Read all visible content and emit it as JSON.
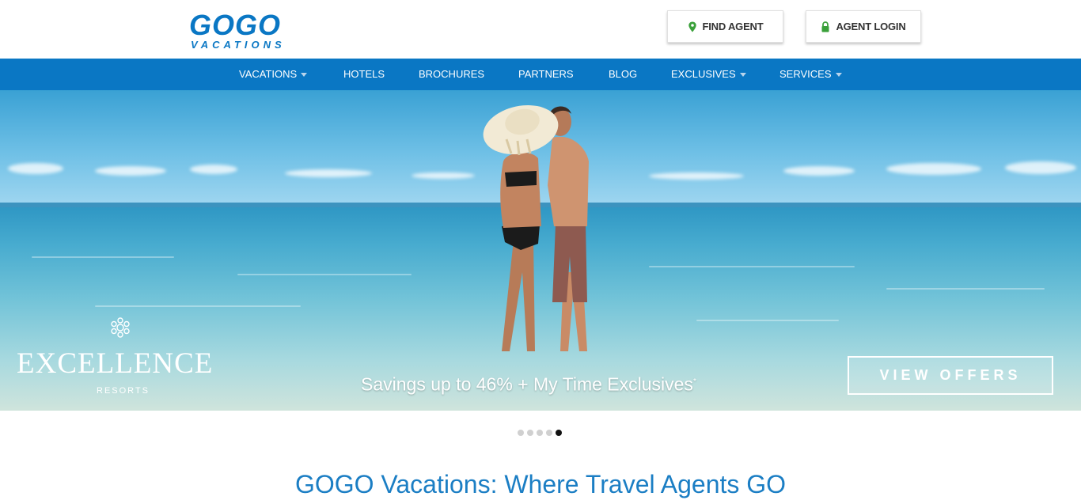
{
  "header": {
    "logo": {
      "main": "GOGO",
      "sub": "VACATIONS"
    },
    "find_agent_label": "FIND AGENT",
    "agent_login_label": "AGENT LOGIN",
    "find_agent_icon": "map-pin-icon",
    "agent_login_icon": "lock-icon",
    "icon_color": "#3aa03a"
  },
  "nav": {
    "background": "#0a77c4",
    "items": [
      {
        "label": "VACATIONS",
        "dropdown": true
      },
      {
        "label": "HOTELS",
        "dropdown": false
      },
      {
        "label": "BROCHURES",
        "dropdown": false
      },
      {
        "label": "PARTNERS",
        "dropdown": false
      },
      {
        "label": "BLOG",
        "dropdown": false
      },
      {
        "label": "EXCLUSIVES",
        "dropdown": true
      },
      {
        "label": "SERVICES",
        "dropdown": true
      }
    ]
  },
  "hero": {
    "brand_name": "EXCELLENCE",
    "brand_sub": "RESORTS",
    "brand_icon": "snowflake-emblem-icon",
    "promo_text": "Savings up to 46% + My Time Exclusives",
    "promo_mark": "*",
    "cta_label": "VIEW OFFERS"
  },
  "carousel": {
    "slide_count": 5,
    "active_index": 4
  },
  "main": {
    "heading": "GOGO Vacations: Where Travel Agents GO"
  }
}
